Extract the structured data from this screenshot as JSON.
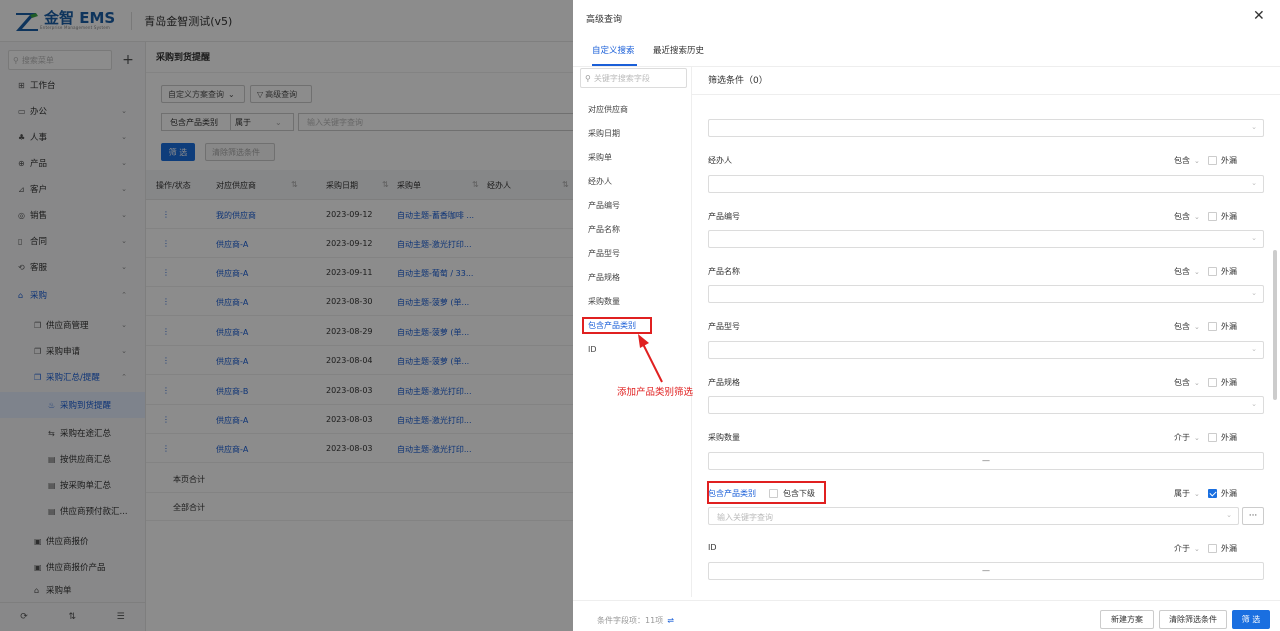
{
  "app": {
    "brand": "金智 EMS",
    "brand_sub": "Enterprise Management System",
    "tenant": "青岛金智测试(v5)"
  },
  "sidebar": {
    "search_placeholder": "搜索菜单",
    "add_label": "+",
    "items": [
      {
        "label": "工作台",
        "icon": "⊞"
      },
      {
        "label": "办公",
        "icon": "▭"
      },
      {
        "label": "人事",
        "icon": "♣"
      },
      {
        "label": "产品",
        "icon": "⊕"
      },
      {
        "label": "客户",
        "icon": "⊿"
      },
      {
        "label": "销售",
        "icon": "◎"
      },
      {
        "label": "合同",
        "icon": "▯"
      },
      {
        "label": "客服",
        "icon": "⟲"
      },
      {
        "label": "采购",
        "icon": "⌂"
      },
      {
        "label": "供应商管理",
        "icon": "❐"
      },
      {
        "label": "采购申请",
        "icon": "❐"
      },
      {
        "label": "采购汇总/提醒",
        "icon": "❐"
      },
      {
        "label": "采购到货提醒",
        "icon": "♨"
      },
      {
        "label": "采购在途汇总",
        "icon": "⇆"
      },
      {
        "label": "按供应商汇总",
        "icon": "▤"
      },
      {
        "label": "按采购单汇总",
        "icon": "▤"
      },
      {
        "label": "供应商预付款汇...",
        "icon": "▤"
      },
      {
        "label": "供应商报价",
        "icon": "▣"
      },
      {
        "label": "供应商报价产品",
        "icon": "▣"
      },
      {
        "label": "采购单",
        "icon": "⌂"
      }
    ],
    "bottom_icons": [
      "⟳",
      "⇅",
      "☰"
    ]
  },
  "main": {
    "title": "采购到货提醒",
    "scheme_select": "自定义方案查询",
    "advanced_btn": "高级查询",
    "filter_field": "包含产品类别",
    "filter_op": "属于",
    "filter_placeholder": "输入关键字查询",
    "filter_btn": "筛 选",
    "clear_btn": "清除筛选条件",
    "columns": [
      "操作/状态",
      "对应供应商",
      "采购日期",
      "采购单",
      "经办人"
    ],
    "rows": [
      {
        "supplier": "我的供应商",
        "date": "2023-09-12",
        "po": "自动主题-蓄香咖啡 ..."
      },
      {
        "supplier": "供应商-A",
        "date": "2023-09-12",
        "po": "自动主题-激光打印..."
      },
      {
        "supplier": "供应商-A",
        "date": "2023-09-11",
        "po": "自动主题-葡萄 / 33..."
      },
      {
        "supplier": "供应商-A",
        "date": "2023-08-30",
        "po": "自动主题-菠萝 (单..."
      },
      {
        "supplier": "供应商-A",
        "date": "2023-08-29",
        "po": "自动主题-菠萝 (单..."
      },
      {
        "supplier": "供应商-A",
        "date": "2023-08-04",
        "po": "自动主题-菠萝 (单..."
      },
      {
        "supplier": "供应商-B",
        "date": "2023-08-03",
        "po": "自动主题-激光打印..."
      },
      {
        "supplier": "供应商-A",
        "date": "2023-08-03",
        "po": "自动主题-激光打印..."
      },
      {
        "supplier": "供应商-A",
        "date": "2023-08-03",
        "po": "自动主题-激光打印..."
      }
    ],
    "row_action": "⋮",
    "page_total": "本页合计",
    "all_total": "全部合计"
  },
  "drawer": {
    "title": "高级查询",
    "close": "✕",
    "tabs": [
      "自定义搜索",
      "最近搜索历史"
    ],
    "field_search_placeholder": "关键字搜索字段",
    "fields": [
      "对应供应商",
      "采购日期",
      "采购单",
      "经办人",
      "产品编号",
      "产品名称",
      "产品型号",
      "产品规格",
      "采购数量",
      "包含产品类别",
      "ID"
    ],
    "condition_count_label": "筛选条件（0）",
    "conditions": [
      {
        "label": "经办人",
        "op": "包含",
        "ext": "外漏",
        "checked": false
      },
      {
        "label": "产品编号",
        "op": "包含",
        "ext": "外漏",
        "checked": false
      },
      {
        "label": "产品名称",
        "op": "包含",
        "ext": "外漏",
        "checked": false
      },
      {
        "label": "产品型号",
        "op": "包含",
        "ext": "外漏",
        "checked": false
      },
      {
        "label": "产品规格",
        "op": "包含",
        "ext": "外漏",
        "checked": false
      },
      {
        "label": "采购数量",
        "op": "介于",
        "ext": "外漏",
        "checked": false
      },
      {
        "label": "包含产品类别",
        "op": "属于",
        "ext": "外漏",
        "checked": true
      },
      {
        "label": "ID",
        "op": "介于",
        "ext": "外漏",
        "checked": false
      }
    ],
    "include_sub_label": "包含下级",
    "category_placeholder": "输入关键字查询",
    "more_btn": "···",
    "range_dash": "—",
    "footer_count": "条件字段项：11项",
    "btn_new": "新建方案",
    "btn_clear": "清除筛选条件",
    "btn_filter": "筛 选"
  },
  "annotation": {
    "text": "添加产品类别筛选",
    "color": "#e02020"
  },
  "colors": {
    "primary": "#1a6fe0",
    "link": "#1a5fd8",
    "annotation": "#e02020"
  }
}
